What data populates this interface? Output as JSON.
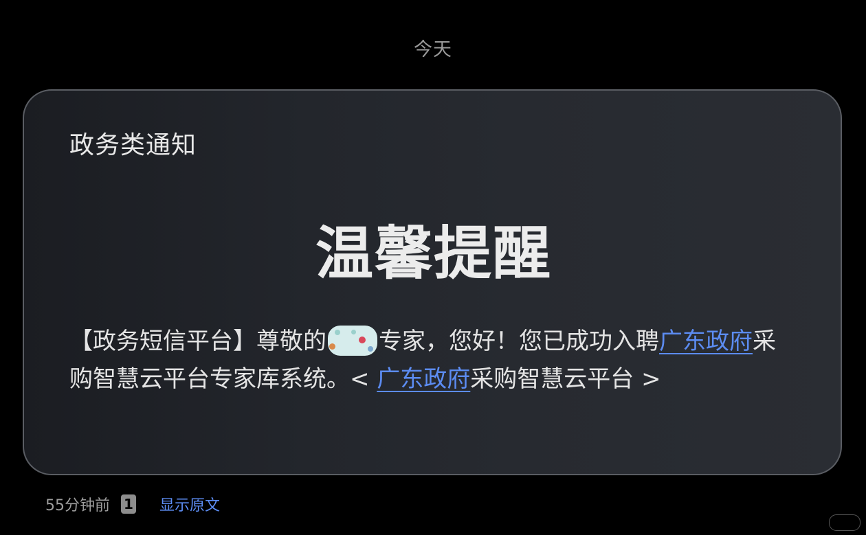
{
  "thread": {
    "date_label": "今天"
  },
  "message": {
    "category": "政务类通知",
    "headline": "温馨提醒",
    "body_parts": {
      "p1": "【政务短信平台】尊敬的",
      "p2": "专家，您好！您已成功入聘",
      "link1": "广东政府",
      "p3": "采购智慧云平台专家库系统。< ",
      "link2": "广东政府",
      "p4": "采购智慧云平台 >"
    },
    "time_ago": "55分钟前",
    "sim_slot": "1",
    "show_original_label": "显示原文"
  },
  "colors": {
    "link": "#5c8cf2",
    "background": "#000000",
    "card": "#23262c"
  }
}
